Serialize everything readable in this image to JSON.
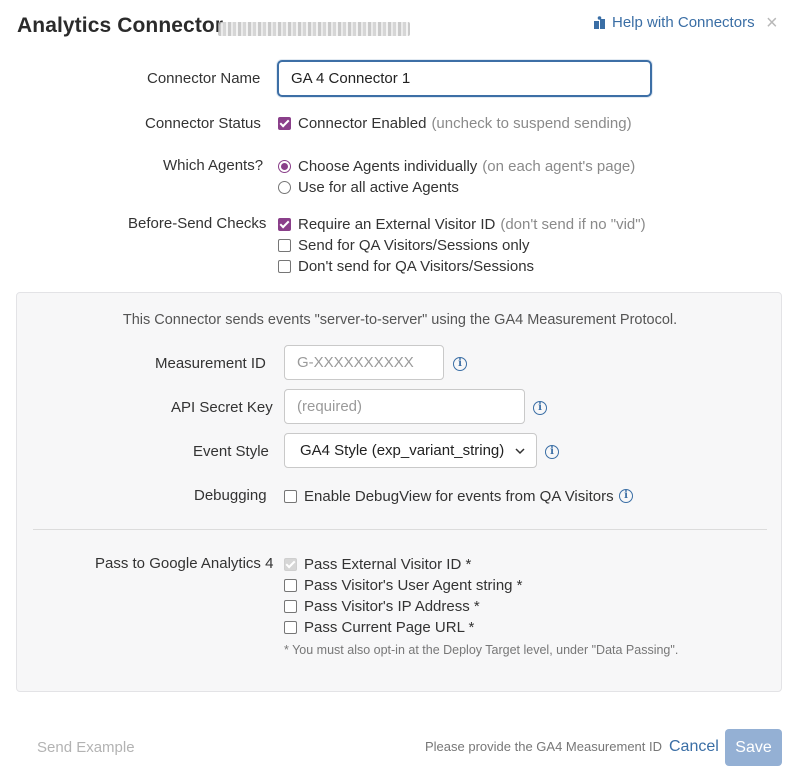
{
  "header": {
    "title": "Analytics Connector",
    "help_link": "Help with Connectors",
    "help_icon": "book-icon",
    "close_icon": "×"
  },
  "form": {
    "name_label": "Connector Name",
    "name_value": "GA 4 Connector 1",
    "status_label": "Connector Status",
    "status_option": {
      "label": "Connector Enabled",
      "hint": "(uncheck to suspend sending)",
      "checked": true
    },
    "agents_label": "Which Agents?",
    "agents_options": [
      {
        "label": "Choose Agents individually",
        "hint": "(on each agent's page)",
        "selected": true
      },
      {
        "label": "Use for all active Agents",
        "hint": "",
        "selected": false
      }
    ],
    "checks_label": "Before-Send Checks",
    "checks_options": [
      {
        "label": "Require an External Visitor ID",
        "hint": "(don't send if no \"vid\")",
        "checked": true
      },
      {
        "label": "Send for QA Visitors/Sessions only",
        "hint": "",
        "checked": false
      },
      {
        "label": "Don't send for QA Visitors/Sessions",
        "hint": "",
        "checked": false
      }
    ]
  },
  "panel": {
    "note": "This Connector sends events \"server-to-server\" using the GA4 Measurement Protocol.",
    "measurement_label": "Measurement ID",
    "measurement_placeholder": "G-XXXXXXXXXX",
    "secret_label": "API Secret Key",
    "secret_placeholder": "(required)",
    "event_label": "Event Style",
    "event_value": "GA4 Style (exp_variant_string)",
    "debug_label": "Debugging",
    "debug_option": "Enable DebugView for events from QA Visitors",
    "pass_label": "Pass to Google Analytics 4",
    "pass_options": [
      {
        "label": "Pass External Visitor ID *",
        "state": "checked-disabled"
      },
      {
        "label": "Pass Visitor's User Agent string *",
        "state": "unchecked"
      },
      {
        "label": "Pass Visitor's IP Address *",
        "state": "unchecked"
      },
      {
        "label": "Pass Current Page URL *",
        "state": "unchecked"
      }
    ],
    "footnote": "* You must also opt-in at the Deploy Target level, under \"Data Passing\"."
  },
  "footer": {
    "send_example": "Send Example",
    "status": "Please provide the GA4 Measurement ID",
    "cancel": "Cancel",
    "save": "Save"
  },
  "colors": {
    "accent": "#8a3f8a",
    "link": "#3a6ea5",
    "save_disabled": "#94b0d4"
  }
}
